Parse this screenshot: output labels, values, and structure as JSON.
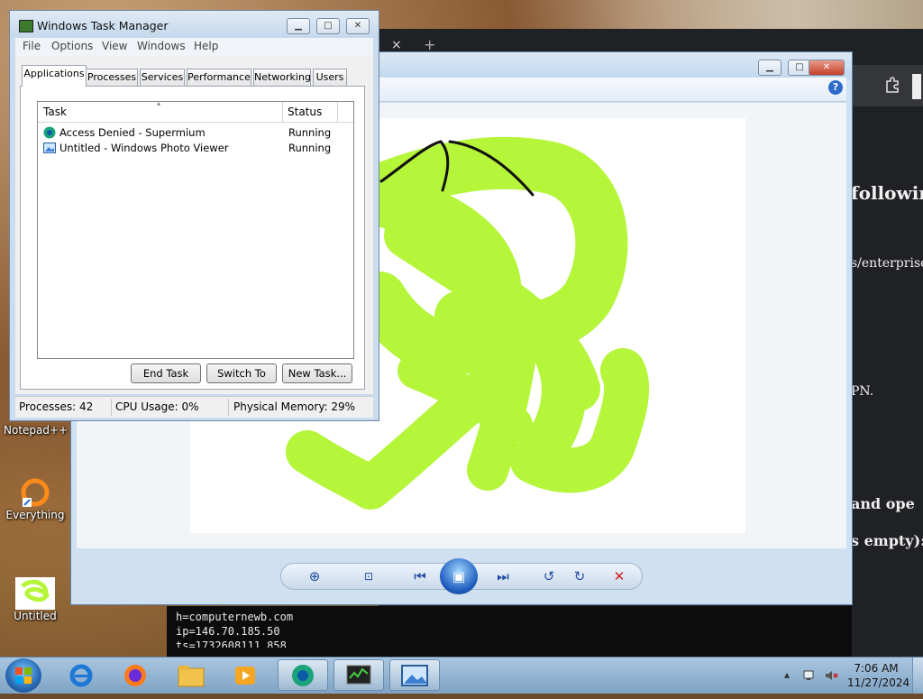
{
  "browser": {
    "tab_close": "×",
    "tab_new": "+",
    "texts": [
      "followin",
      "s/enterprise-",
      "PN.",
      "and ope",
      "s empty):"
    ]
  },
  "terminal": {
    "lines": [
      "h=computernewb.com",
      "ip=146.70.185.50",
      "ts=1732608111.858"
    ]
  },
  "desktop": {
    "icons": [
      {
        "label": "Notepad++",
        "icon": "notepad-plus-icon"
      },
      {
        "label": "Everything",
        "icon": "everything-search-icon"
      },
      {
        "label": "Untitled",
        "icon": "image-file-icon"
      }
    ]
  },
  "photo_viewer": {
    "help": "?",
    "image_accent": "#b5f53a"
  },
  "task_manager": {
    "title": "Windows Task Manager",
    "menu": [
      "File",
      "Options",
      "View",
      "Windows",
      "Help"
    ],
    "tabs": [
      "Applications",
      "Processes",
      "Services",
      "Performance",
      "Networking",
      "Users"
    ],
    "active_tab": "Applications",
    "columns": {
      "task": "Task",
      "status": "Status"
    },
    "tasks": [
      {
        "name": "Access Denied - Supermium",
        "status": "Running",
        "icon": "supermium-icon"
      },
      {
        "name": "Untitled - Windows Photo Viewer",
        "status": "Running",
        "icon": "photo-viewer-icon"
      }
    ],
    "buttons": {
      "end_task": "End Task",
      "switch_to": "Switch To",
      "new_task": "New Task..."
    },
    "status": {
      "processes": "Processes: 42",
      "cpu": "CPU Usage: 0%",
      "memory": "Physical Memory: 29%"
    }
  },
  "taskbar": {
    "time": "7:06 AM",
    "date": "11/27/2024",
    "pinned": [
      "internet-explorer-icon",
      "firefox-icon",
      "file-explorer-icon",
      "media-player-icon",
      "supermium-icon",
      "task-manager-icon",
      "photo-viewer-icon"
    ]
  }
}
